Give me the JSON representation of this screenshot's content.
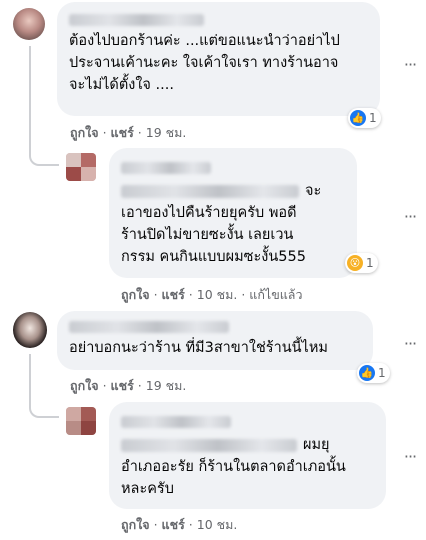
{
  "actions": {
    "like": "ถูกใจ",
    "reply": "แชร์",
    "separator": "·",
    "edited": "แก้ไขแล้ว"
  },
  "comments": [
    {
      "time": "19 ชม.",
      "text": "ต้องไปบอกร้านค่ะ ...แต่ขอแนะนำว่าอย่าไป\nประจานเค้านะคะ ใจเค้าใจเรา ทางร้านอาจ\nจะไม่ได้ตั้งใจ ....",
      "reaction": {
        "icon": "like",
        "count": "1"
      }
    },
    {
      "time": "10 ชม.",
      "text_first_line_end": "จะ",
      "text": "เอาของไปคืนร้ายยุครับ พอดี\nร้านปิดไม่ขายซะงั้น เลยเวน\nกรรม คนกินแบบผมซะงั้น555",
      "reaction": {
        "icon": "wow",
        "count": "1"
      },
      "edited": true
    },
    {
      "time": "19 ชม.",
      "text": "อย่าบอกนะว่าร้าน ที่มี3สาขาใช่ร้านนี้ไหม",
      "reaction": {
        "icon": "like",
        "count": "1"
      }
    },
    {
      "time": "10 ชม.",
      "text_first_line_end": "ผมยุ",
      "text": "อำเภออะรัย ก็ร้านในตลาดอำเภอนั้น\nหละครับ"
    }
  ],
  "colors": {
    "bubble": "#f0f2f5",
    "meta": "#65676b",
    "like": "#1877f2",
    "wow": "#f7b125"
  }
}
